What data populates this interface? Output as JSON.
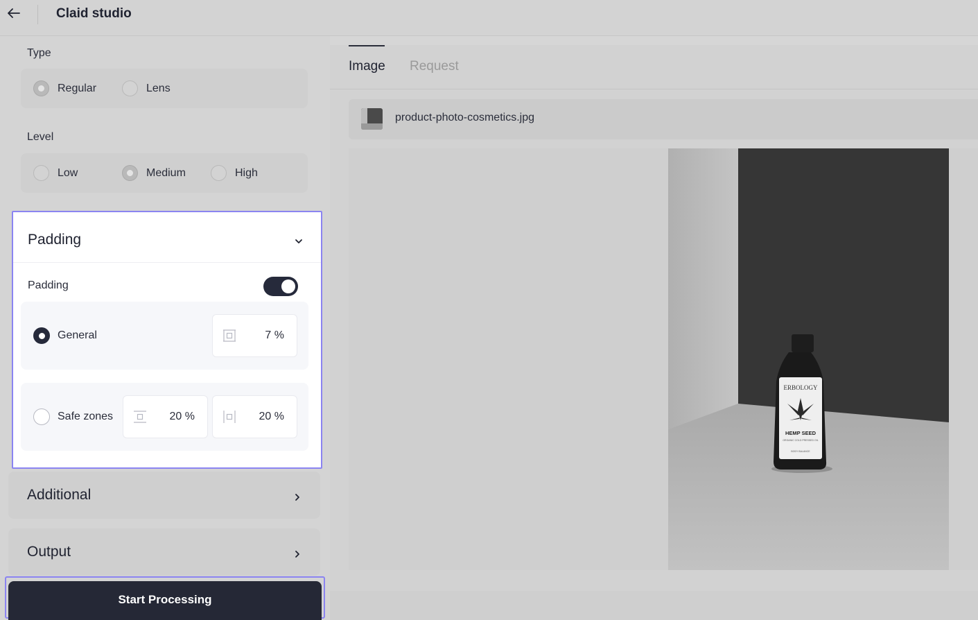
{
  "header": {
    "title": "Claid studio"
  },
  "type_section": {
    "label": "Type",
    "options": [
      {
        "label": "Regular",
        "selected": true
      },
      {
        "label": "Lens",
        "selected": false
      }
    ]
  },
  "level_section": {
    "label": "Level",
    "options": [
      {
        "label": "Low",
        "selected": false
      },
      {
        "label": "Medium",
        "selected": true
      },
      {
        "label": "High",
        "selected": false
      }
    ]
  },
  "padding_card": {
    "title": "Padding",
    "toggle_label": "Padding",
    "toggle_on": true,
    "general": {
      "label": "General",
      "selected": true,
      "value": "7 %"
    },
    "safe_zones": {
      "label": "Safe zones",
      "selected": false,
      "vertical_value": "20 %",
      "horizontal_value": "20 %"
    }
  },
  "additional_section": {
    "title": "Additional"
  },
  "output_section": {
    "title": "Output"
  },
  "start_button": {
    "label": "Start Processing"
  },
  "main": {
    "tabs": [
      {
        "label": "Image",
        "active": true
      },
      {
        "label": "Request",
        "active": false
      }
    ],
    "file_name": "product-photo-cosmetics.jpg",
    "photo": {
      "brand": "ERBOLOGY",
      "product": "HEMP SEED",
      "subline": "ORGANIC COLD PRESSED OIL",
      "footer": "BODY BALANCE"
    }
  },
  "colors": {
    "accent_outline": "#8b84f1",
    "primary_dark": "#252836"
  }
}
